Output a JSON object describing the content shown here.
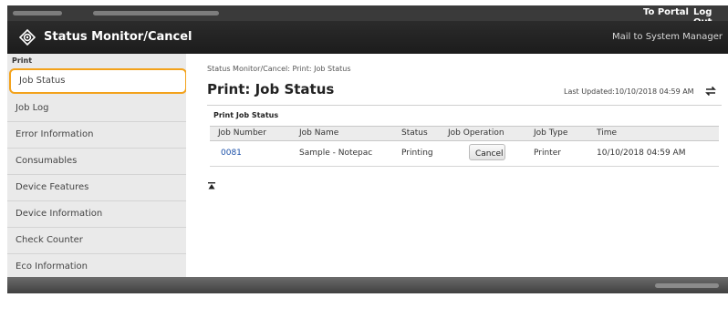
{
  "topbar": {
    "portal_link": "To Portal",
    "logout_link": "Log Out"
  },
  "header": {
    "title": "Status Monitor/Cancel",
    "mail_link": "Mail to System Manager"
  },
  "sidebar": {
    "section_label": "Print",
    "items": [
      {
        "label": "Job Status"
      },
      {
        "label": "Job Log"
      },
      {
        "label": "Error Information"
      },
      {
        "label": "Consumables"
      },
      {
        "label": "Device Features"
      },
      {
        "label": "Device Information"
      },
      {
        "label": "Check Counter"
      },
      {
        "label": "Eco Information"
      }
    ]
  },
  "main": {
    "breadcrumb": "Status Monitor/Cancel: Print: Job Status",
    "title": "Print: Job Status",
    "last_updated": "Last Updated:10/10/2018 04:59 AM",
    "section_title": "Print Job Status",
    "table": {
      "headers": [
        "Job Number",
        "Job Name",
        "Status",
        "Job Operation",
        "Job Type",
        "Time"
      ],
      "rows": [
        {
          "job_number": "0081",
          "job_name": "Sample - Notepac",
          "status": "Printing",
          "operation": "Cancel",
          "job_type": "Printer",
          "time": "10/10/2018 04:59 AM"
        }
      ]
    }
  },
  "colors": {
    "active_border": "#f3a21b",
    "header_bg": "#2b2b2b",
    "link": "#1a4fa8"
  }
}
